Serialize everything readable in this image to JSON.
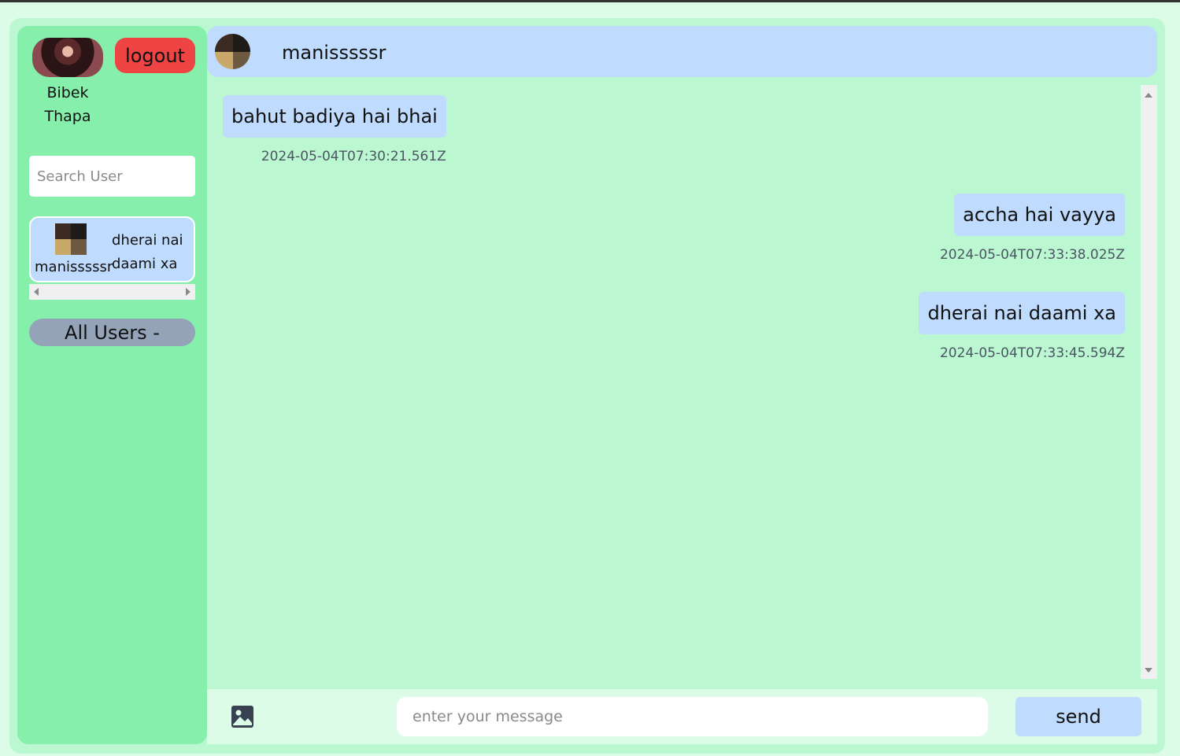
{
  "sidebar": {
    "user_first_name": "Bibek",
    "user_last_name": "Thapa",
    "logout_label": "logout",
    "search_placeholder": "Search User",
    "conversations": [
      {
        "name": "manisssssr",
        "last_message": "dherai nai daami xa"
      }
    ],
    "all_users_label": "All Users -"
  },
  "chat": {
    "header_name": "manisssssr",
    "messages": [
      {
        "side": "left",
        "text": "bahut badiya hai bhai",
        "timestamp": "2024-05-04T07:30:21.561Z"
      },
      {
        "side": "right",
        "text": "accha hai vayya",
        "timestamp": "2024-05-04T07:33:38.025Z"
      },
      {
        "side": "right",
        "text": "dherai nai daami xa",
        "timestamp": "2024-05-04T07:33:45.594Z"
      }
    ],
    "input_placeholder": "enter your message",
    "send_label": "send",
    "attach_icon": "image-icon"
  },
  "colors": {
    "page_bg": "#dcfce7",
    "frame_bg": "#bbf7d0",
    "sidebar_bg": "#86efac",
    "bubble_bg": "#bfdbfe",
    "logout_bg": "#ef4444",
    "all_users_bg": "#94a3b8"
  }
}
